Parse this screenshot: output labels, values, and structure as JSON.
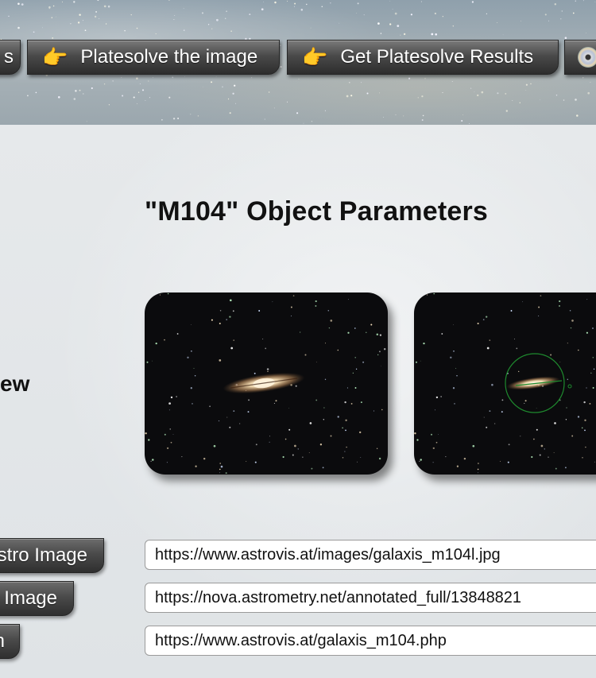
{
  "nav": {
    "left_partial_label": "s",
    "platesolve_label": "Platesolve the image",
    "results_label": "Get Platesolve Results",
    "hand_icon": "pointing-hand-icon",
    "cd_icon": "cd-icon"
  },
  "main": {
    "title": "\"M104\" Object Parameters",
    "side_label": "ew"
  },
  "images": {
    "astro_alt": "M104 astro image",
    "annotated_alt": "M104 annotated image"
  },
  "links": [
    {
      "button_label": "stro Image",
      "url": "https://www.astrovis.at/images/galaxis_m104l.jpg"
    },
    {
      "button_label": "Image",
      "url": "https://nova.astrometry.net/annotated_full/13848821"
    },
    {
      "button_label": "n",
      "url": "https://www.astrovis.at/galaxis_m104.php"
    }
  ],
  "colors": {
    "button_dark": "#2d2d2d",
    "annotation_green": "#1e8a2e",
    "galaxy_core": "#f5e3c2"
  }
}
